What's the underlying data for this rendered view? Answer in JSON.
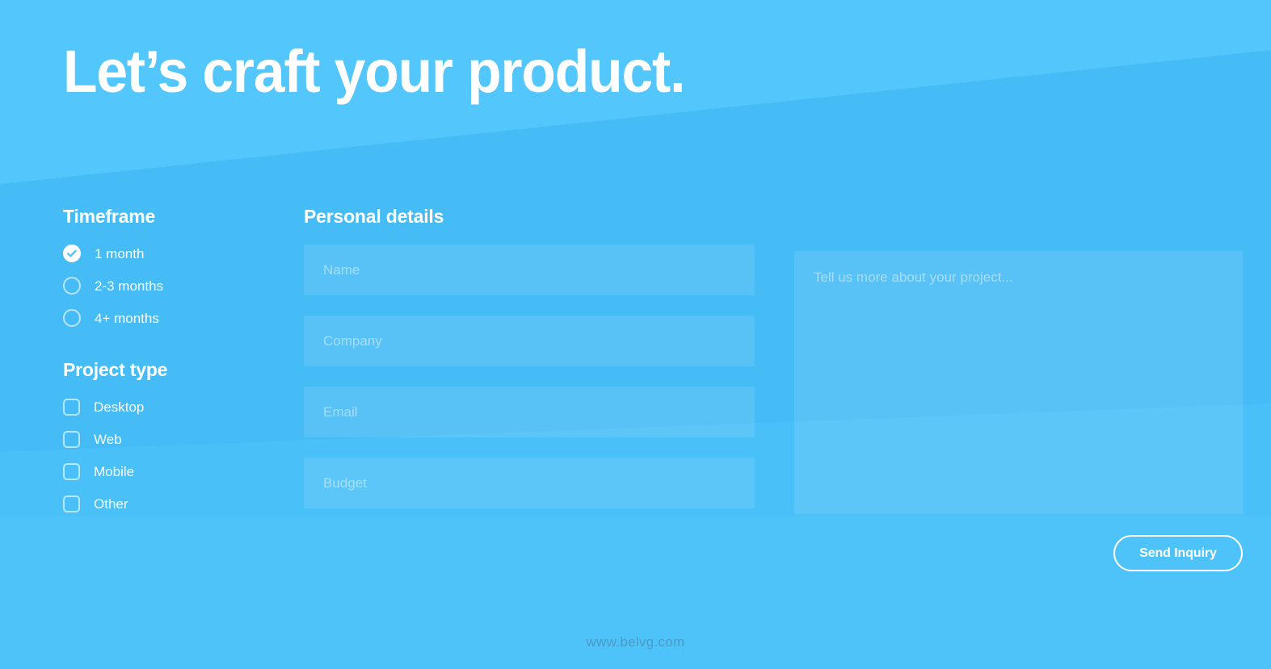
{
  "theme": {
    "bg_top": "#53c6fb",
    "bg_bottom": "#46bcf7",
    "accent_white": "#ffffff",
    "field_fill": "rgba(255,255,255,0.10)",
    "placeholder": "rgba(255,255,255,0.46)"
  },
  "hero": {
    "title": "Let’s craft your product."
  },
  "timeframe": {
    "heading": "Timeframe",
    "options": [
      {
        "label": "1 month",
        "selected": true
      },
      {
        "label": "2-3 months",
        "selected": false
      },
      {
        "label": "4+ months",
        "selected": false
      }
    ]
  },
  "project_type": {
    "heading": "Project type",
    "options": [
      {
        "label": "Desktop",
        "checked": false
      },
      {
        "label": "Web",
        "checked": false
      },
      {
        "label": "Mobile",
        "checked": false
      },
      {
        "label": "Other",
        "checked": false
      }
    ]
  },
  "personal_details": {
    "heading": "Personal details",
    "fields": [
      {
        "name": "name",
        "placeholder": "Name",
        "value": ""
      },
      {
        "name": "company",
        "placeholder": "Company",
        "value": ""
      },
      {
        "name": "email",
        "placeholder": "Email",
        "value": ""
      },
      {
        "name": "budget",
        "placeholder": "Budget",
        "value": ""
      }
    ]
  },
  "message": {
    "placeholder": "Tell us more about your project...",
    "value": ""
  },
  "submit": {
    "label": "Send Inquiry"
  },
  "footer": {
    "watermark": "www.belvg.com"
  },
  "icons": {
    "check": "check-icon"
  }
}
